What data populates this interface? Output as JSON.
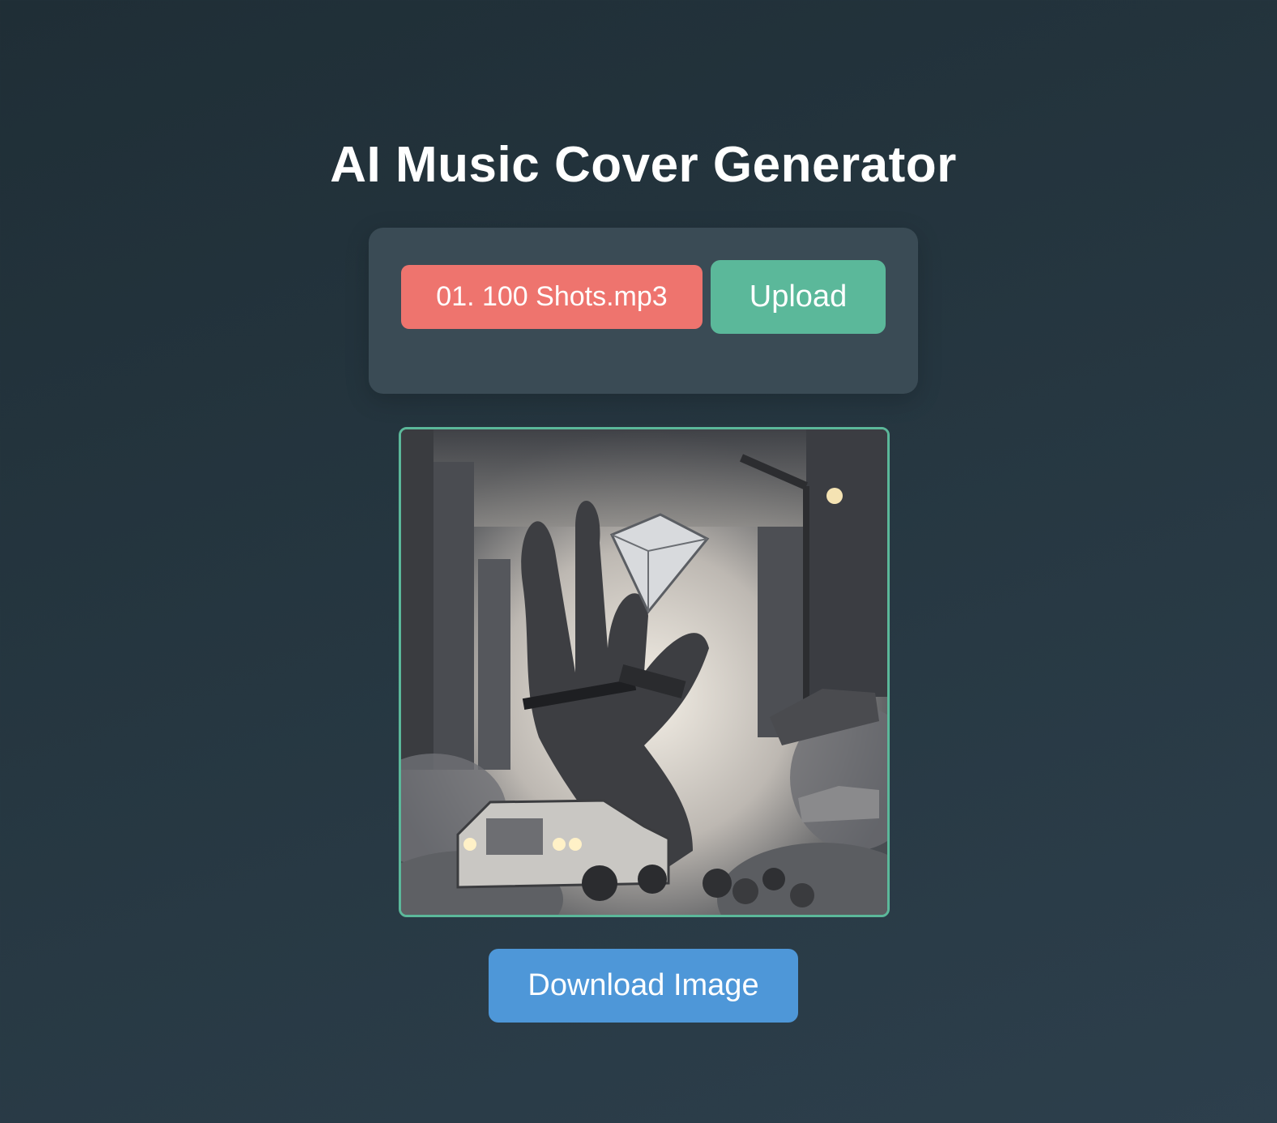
{
  "header": {
    "title": "AI Music Cover Generator"
  },
  "upload_panel": {
    "selected_file": "01. 100 Shots.mp3",
    "upload_label": "Upload"
  },
  "cover": {
    "image_name": "generated-cover-image"
  },
  "actions": {
    "download_label": "Download Image"
  },
  "colors": {
    "background": "#263741",
    "panel": "#3a4b55",
    "file_chip": "#ee746e",
    "upload_button": "#5bb89a",
    "download_button": "#4e97d8",
    "cover_border": "#5bb89a"
  }
}
